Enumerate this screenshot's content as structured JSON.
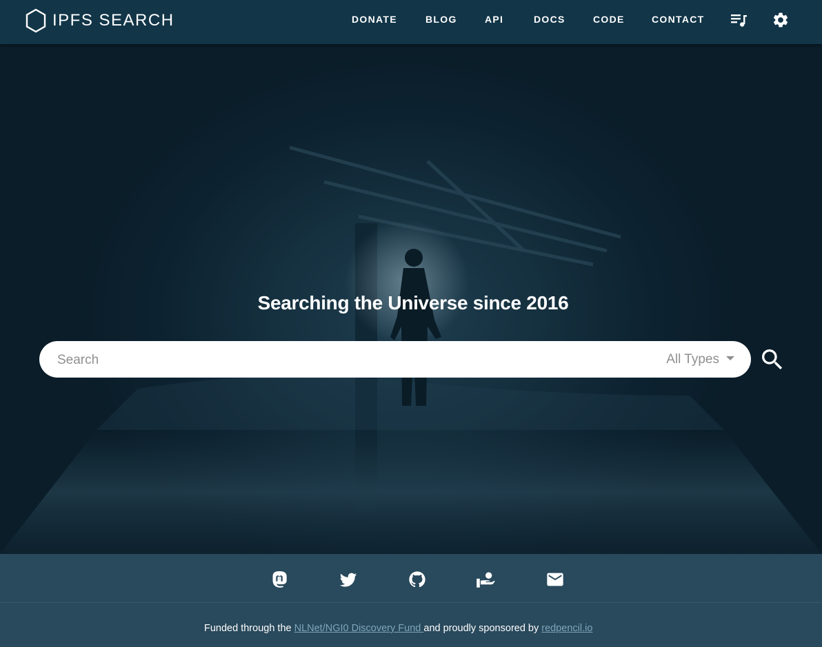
{
  "brand": {
    "name": "IPFS SEARCH",
    "icon": "hexagon-logo-icon"
  },
  "nav": {
    "links": [
      {
        "label": "DONATE"
      },
      {
        "label": "BLOG"
      },
      {
        "label": "API"
      },
      {
        "label": "DOCS"
      },
      {
        "label": "CODE"
      },
      {
        "label": "CONTACT"
      }
    ],
    "icons": [
      "playlist-music-icon",
      "gear-icon"
    ]
  },
  "hero": {
    "tagline": "Searching the Universe since 2016",
    "search": {
      "placeholder": "Search",
      "value": "",
      "type_selected": "All Types",
      "button_icon": "search-icon"
    }
  },
  "social": {
    "icons": [
      "mastodon-icon",
      "twitter-icon",
      "github-icon",
      "donate-hand-icon",
      "email-icon"
    ]
  },
  "footer": {
    "prefix": "Funded through the ",
    "fund_link": "NLNet/NGI0 Discovery Fund ",
    "middle": "and proudly sponsored by ",
    "sponsor_link": "redpencil.io"
  },
  "colors": {
    "header_bg": "#123548",
    "hero_bg": "#0b1f2c",
    "footer_bg": "#29495c",
    "link": "#7fa6ba"
  }
}
